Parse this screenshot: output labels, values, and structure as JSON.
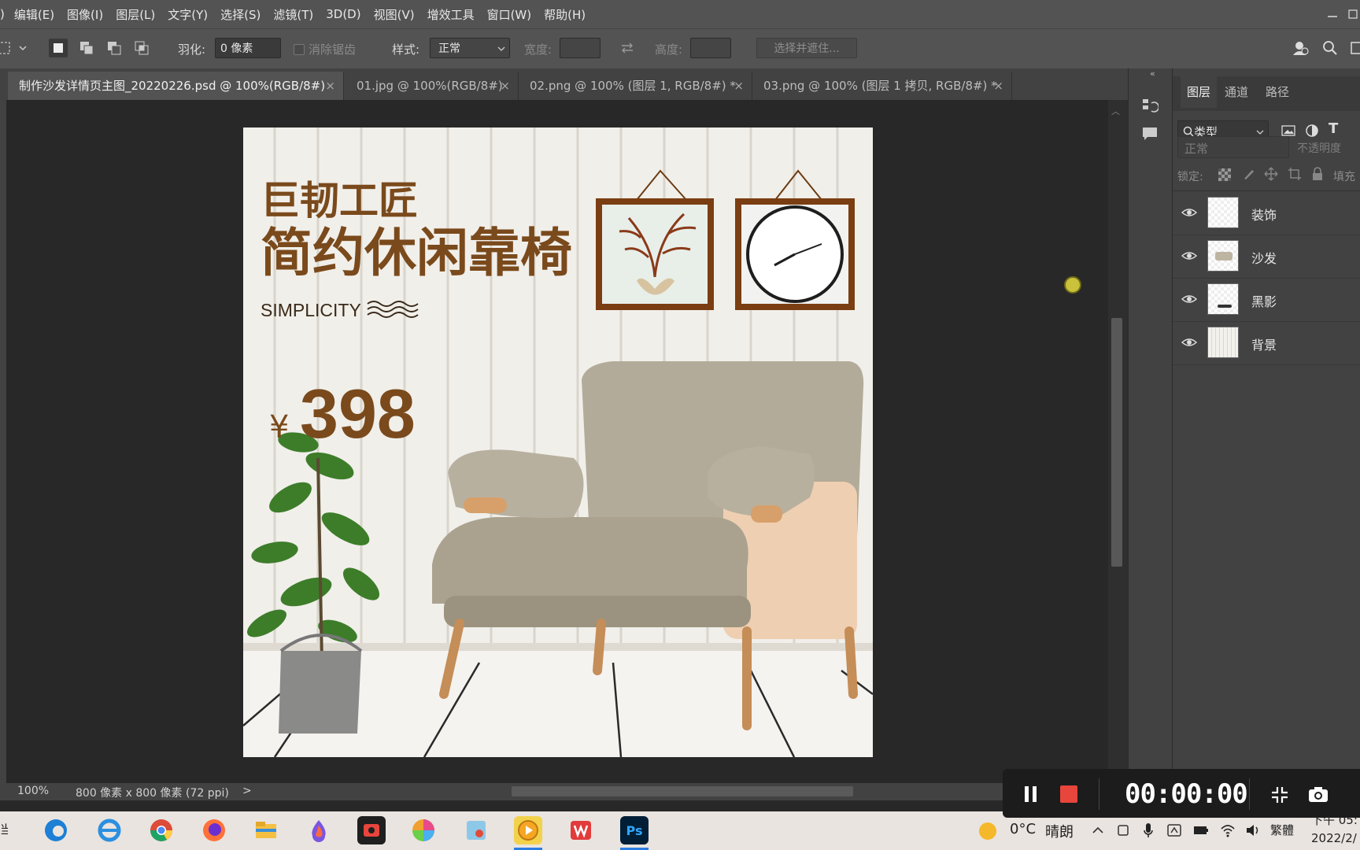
{
  "menu": {
    "items": [
      ")",
      "编辑(E)",
      "图像(I)",
      "图层(L)",
      "文字(Y)",
      "选择(S)",
      "滤镜(T)",
      "3D(D)",
      "视图(V)",
      "增效工具",
      "窗口(W)",
      "帮助(H)"
    ]
  },
  "options": {
    "feather_label": "羽化:",
    "feather_value": "0 像素",
    "antialias_label": "消除锯齿",
    "style_label": "样式:",
    "style_value": "正常",
    "width_label": "宽度:",
    "height_label": "高度:",
    "select_mask_label": "选择并遮住..."
  },
  "tabs": [
    {
      "label": "制作沙发详情页主图_20220226.psd @ 100%(RGB/8#)",
      "close": "×",
      "active": true
    },
    {
      "label": "01.jpg @ 100%(RGB/8#)",
      "close": "×",
      "active": false
    },
    {
      "label": "02.png @ 100% (图层 1, RGB/8#) *",
      "close": "×",
      "active": false
    },
    {
      "label": "03.png @ 100% (图层 1 拷贝, RGB/8#) *",
      "close": "×",
      "active": false
    }
  ],
  "document": {
    "line1": "巨韧工匠",
    "line2": "简约休闲靠椅",
    "line3": "SIMPLICITY",
    "currency": "¥",
    "price": "398"
  },
  "status": {
    "zoom": "100%",
    "doc_size": "800 像素 x 800 像素 (72 ppi)",
    "arrow": ">"
  },
  "layers_panel": {
    "tabs": [
      "图层",
      "通道",
      "路径"
    ],
    "filter_label": "类型",
    "blend_mode": "正常",
    "opacity_label": "不透明度",
    "lock_label": "锁定:",
    "fill_label": "填充",
    "layers": [
      {
        "name": "装饰"
      },
      {
        "name": "沙发"
      },
      {
        "name": "黑影"
      },
      {
        "name": "背景"
      }
    ]
  },
  "recorder": {
    "timer": "00:00:00"
  },
  "taskbar": {
    "weather_temp": "0°C",
    "weather_desc": "晴朗",
    "ime": "繁體",
    "time": "下午 05:",
    "date": "2022/2/",
    "left_edge": "当"
  },
  "colors": {
    "brand_brown": "#7a4a1c",
    "ps_blue": "#31a8ff",
    "record_red": "#e8453c"
  }
}
